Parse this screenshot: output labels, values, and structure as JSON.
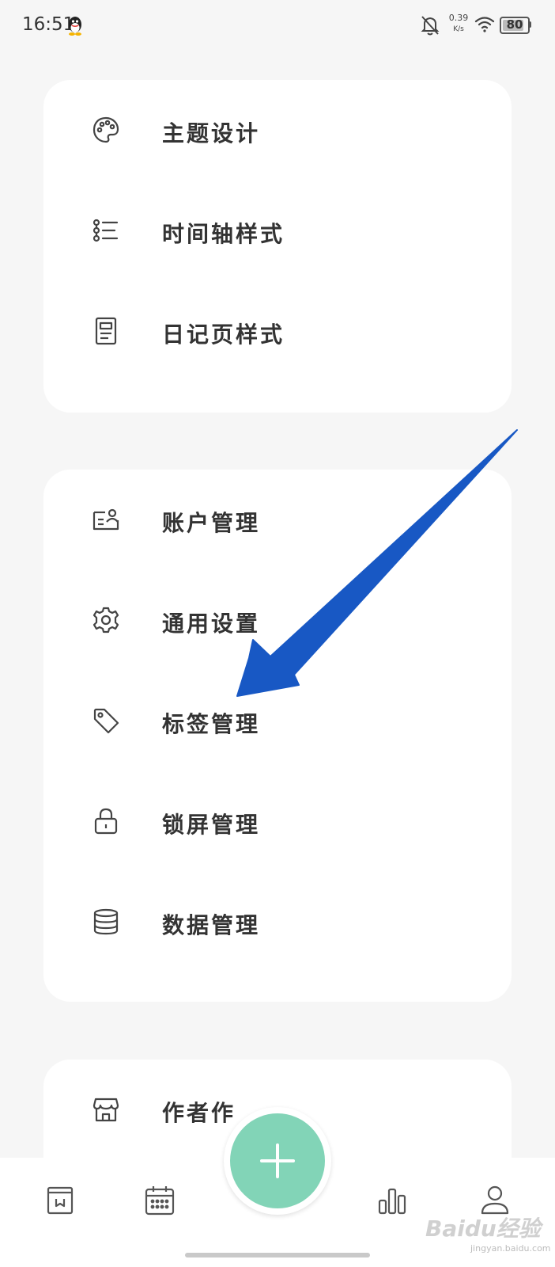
{
  "status_bar": {
    "time": "16:51",
    "net_speed_value": "0.39",
    "net_speed_unit": "K/s",
    "battery": "80"
  },
  "group1": {
    "items": [
      {
        "label": "主题设计",
        "icon": "palette-icon"
      },
      {
        "label": "时间轴样式",
        "icon": "timeline-list-icon"
      },
      {
        "label": "日记页样式",
        "icon": "document-page-icon"
      }
    ]
  },
  "group2": {
    "items": [
      {
        "label": "账户管理",
        "icon": "account-card-icon"
      },
      {
        "label": "通用设置",
        "icon": "gear-icon"
      },
      {
        "label": "标签管理",
        "icon": "tag-icon"
      },
      {
        "label": "锁屏管理",
        "icon": "lock-icon"
      },
      {
        "label": "数据管理",
        "icon": "database-icon"
      }
    ]
  },
  "group3": {
    "items": [
      {
        "label": "作者作",
        "icon": "store-icon"
      }
    ]
  },
  "bottom_nav": {
    "items": [
      {
        "icon": "diary-book-icon"
      },
      {
        "icon": "calendar-icon"
      },
      {
        "icon": "add-icon"
      },
      {
        "icon": "bar-chart-icon"
      },
      {
        "icon": "profile-icon"
      }
    ]
  },
  "colors": {
    "accent_fab": "#82d4b7",
    "annotation_arrow": "#1858c4",
    "background": "#f6f6f6",
    "card": "#ffffff"
  },
  "watermark": {
    "text": "Baidu经验",
    "sub": "jingyan.baidu.com"
  }
}
